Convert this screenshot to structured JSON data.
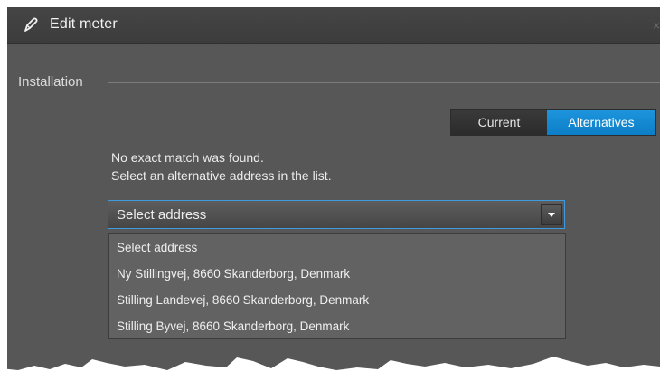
{
  "dialog": {
    "title": "Edit meter",
    "close_glyph": "×",
    "title_icon": "pencil-icon"
  },
  "installation": {
    "section_label": "Installation",
    "toggle": {
      "current_label": "Current",
      "alternatives_label": "Alternatives",
      "selected": "Alternatives"
    },
    "message_line1": "No exact match was found.",
    "message_line2": "Select an alternative address in the list.",
    "address_select": {
      "value": "Select address",
      "options": [
        "Select address",
        "Ny Stillingvej, 8660 Skanderborg, Denmark",
        "Stilling Landevej, 8660 Skanderborg, Denmark",
        "Stilling Byvej, 8660 Skanderborg, Denmark"
      ]
    }
  },
  "colors": {
    "dialog_bg": "#575757",
    "titlebar_bg": "#3f3f3f",
    "accent_blue": "#0f86d0",
    "focus_border": "#3f9be0",
    "text": "#ececec"
  }
}
